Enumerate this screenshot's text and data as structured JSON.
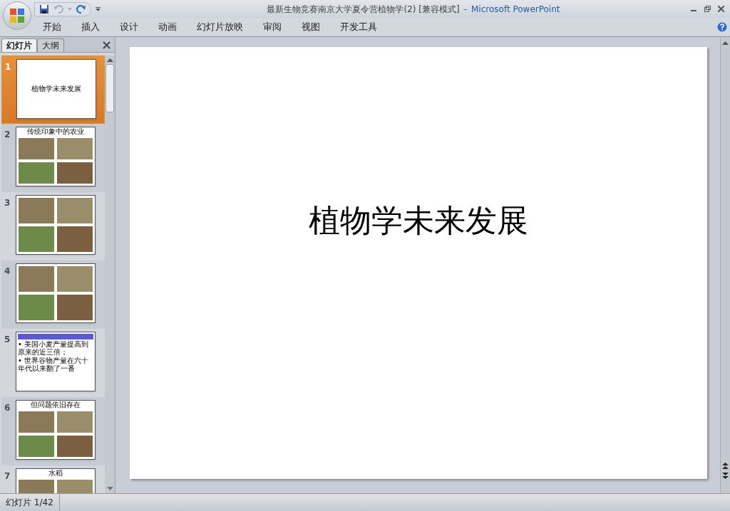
{
  "window": {
    "title": "最新生物竞赛南京大学夏令营植物学(2) [兼容模式]",
    "separator": "-",
    "app_name": "Microsoft PowerPoint"
  },
  "ribbon_tabs": [
    {
      "label": "开始"
    },
    {
      "label": "插入"
    },
    {
      "label": "设计"
    },
    {
      "label": "动画"
    },
    {
      "label": "幻灯片放映"
    },
    {
      "label": "审阅"
    },
    {
      "label": "视图"
    },
    {
      "label": "开发工具"
    }
  ],
  "panel_tabs": [
    {
      "label": "幻灯片",
      "selected": true
    },
    {
      "label": "大纲",
      "selected": false
    }
  ],
  "slides": [
    {
      "number": "1",
      "selected": true,
      "kind": "title",
      "title": "植物学未来发展"
    },
    {
      "number": "2",
      "selected": false,
      "kind": "photos",
      "title": "传统印象中的农业"
    },
    {
      "number": "3",
      "selected": false,
      "kind": "photos"
    },
    {
      "number": "4",
      "selected": false,
      "kind": "photos"
    },
    {
      "number": "5",
      "selected": false,
      "kind": "bullets",
      "bullets": [
        "• 美国小麦产量提高到原来的近三倍；",
        "• 世界谷物产量在六十年代以来翻了一番"
      ]
    },
    {
      "number": "6",
      "selected": false,
      "kind": "photos",
      "title": "但问题依旧存在"
    },
    {
      "number": "7",
      "selected": false,
      "kind": "photos",
      "title": "水稻"
    }
  ],
  "slide_canvas": {
    "title": "植物学未来发展"
  },
  "status_bar": {
    "slide_counter": "幻灯片 1/42"
  }
}
